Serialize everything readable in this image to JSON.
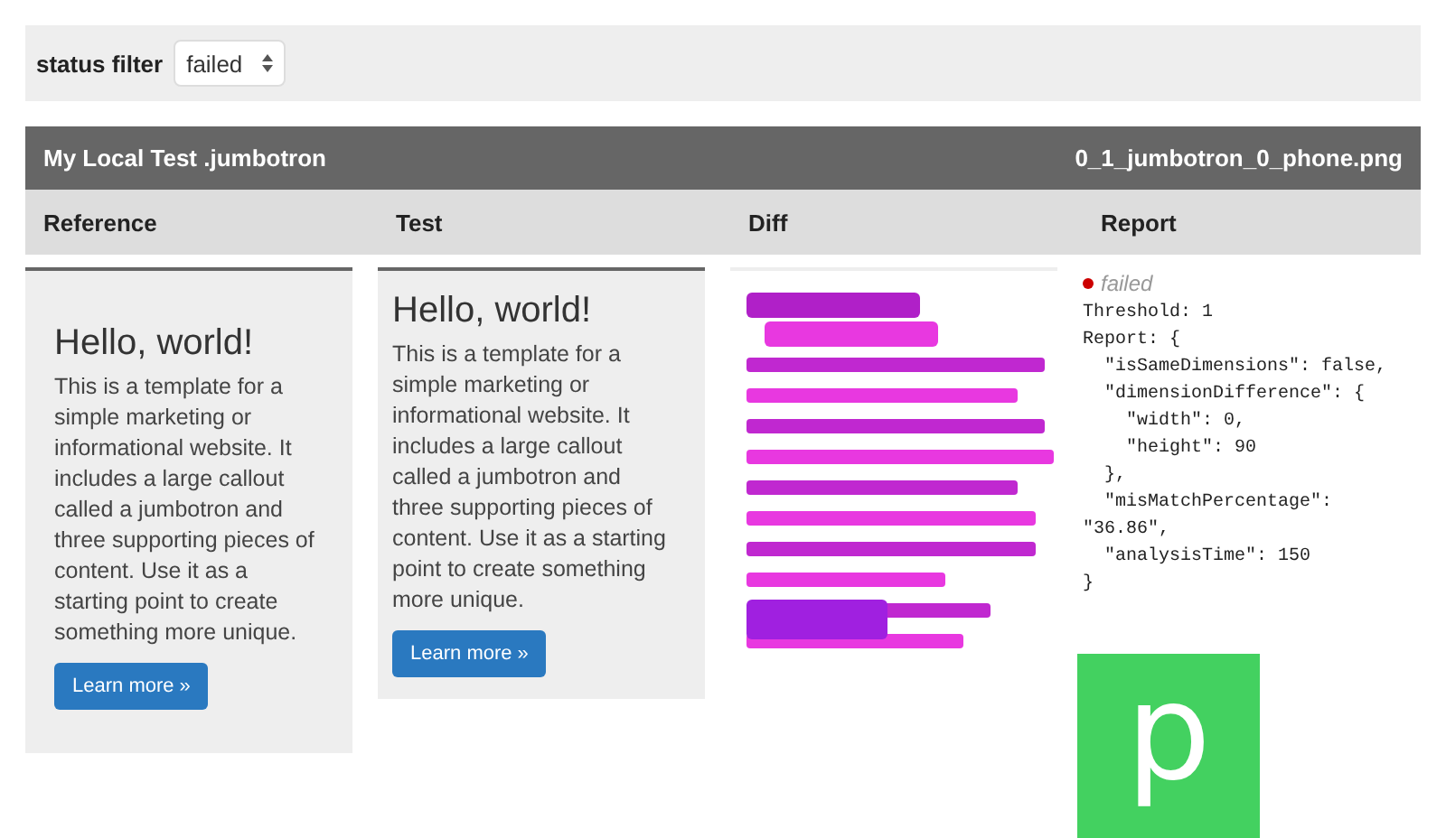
{
  "filter": {
    "label": "status filter",
    "value": "failed"
  },
  "test_header": {
    "title": "My Local Test .jumbotron",
    "file": "0_1_jumbotron_0_phone.png"
  },
  "columns": [
    "Reference",
    "Test",
    "Diff",
    "Report"
  ],
  "reference": {
    "heading": "Hello, world!",
    "body": "This is a template for a simple marketing or informational website. It includes a large callout called a jumbotron and three supporting pieces of content. Use it as a starting point to create something more unique.",
    "button": "Learn more »"
  },
  "test": {
    "heading": "Hello, world!",
    "body": "This is a template for a simple marketing or informational website. It includes a large callout called a jumbotron and three supporting pieces of content. Use it as a starting point to create something more unique.",
    "button": "Learn more »"
  },
  "report": {
    "status": "failed",
    "text": "Threshold: 1\nReport: {\n  \"isSameDimensions\": false,\n  \"dimensionDifference\": {\n    \"width\": 0,\n    \"height\": 90\n  },\n  \"misMatchPercentage\":\n\"36.86\",\n  \"analysisTime\": 150\n}"
  },
  "logo": {
    "letter": "p"
  }
}
